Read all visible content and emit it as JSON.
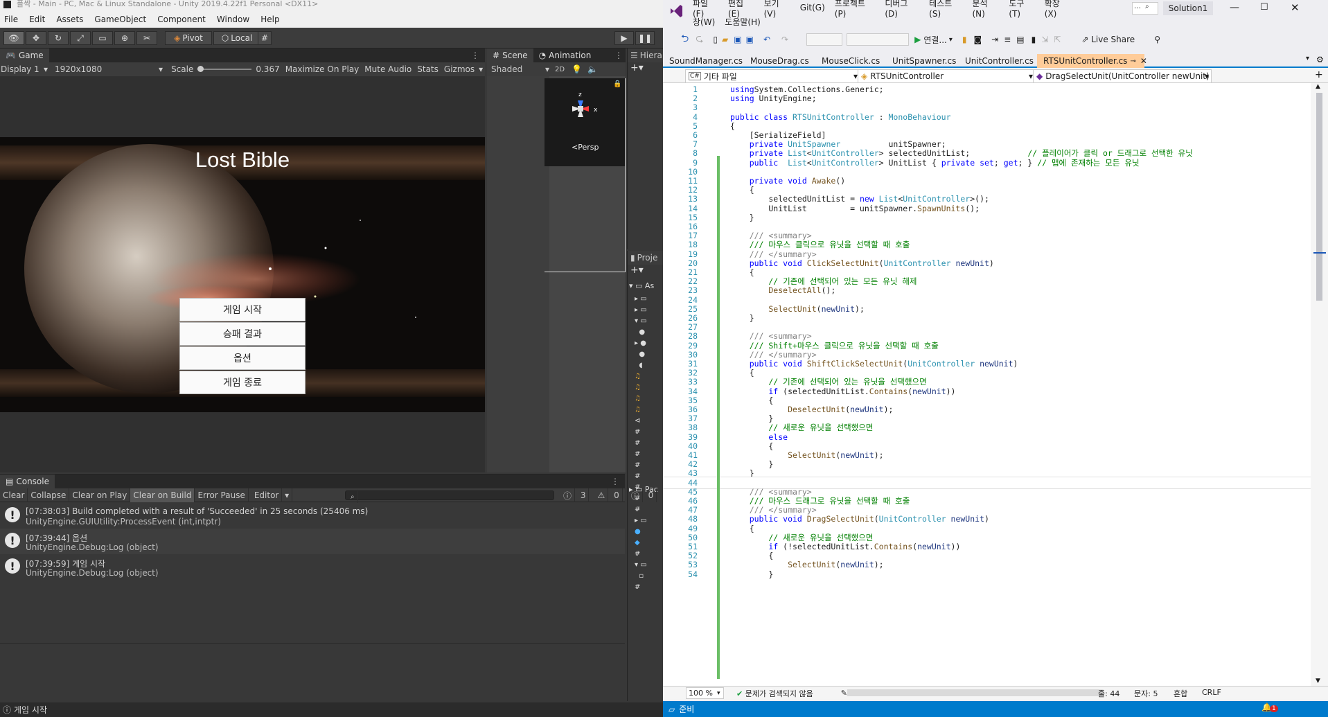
{
  "unity": {
    "window_title": "플싹 - Main - PC, Mac & Linux Standalone - Unity 2019.4.22f1 Personal <DX11>",
    "menu": [
      "File",
      "Edit",
      "Assets",
      "GameObject",
      "Component",
      "Window",
      "Help"
    ],
    "toolbar": {
      "pivot": "Pivot",
      "local": "Local"
    },
    "game_tab": "Game",
    "game_bar": {
      "display": "Display 1",
      "resolution": "1920x1080",
      "scale_label": "Scale",
      "scale_value": "0.367",
      "maximize": "Maximize On Play",
      "mute": "Mute Audio",
      "stats": "Stats",
      "gizmos": "Gizmos"
    },
    "game": {
      "title": "Lost Bible",
      "buttons": [
        "게임 시작",
        "승패 결과",
        "옵션",
        "게임 종료"
      ]
    },
    "scene_tabs": {
      "scene": "Scene",
      "animation": "Animation"
    },
    "scene_bar": {
      "shading": "Shaded",
      "mode": "2D"
    },
    "scene_persp": "Persp",
    "hierarchy_tab": "Hiera",
    "project_tab": "Proje",
    "project_root": "As",
    "project_pkg": "Pac",
    "console": {
      "tab": "Console",
      "toolbar": [
        "Clear",
        "Collapse",
        "Clear on Play",
        "Clear on Build",
        "Error Pause",
        "Editor"
      ],
      "counts": {
        "log": "3",
        "warn": "0",
        "error": "0"
      },
      "logs": [
        {
          "line1": "[07:38:03] Build completed with a result of 'Succeeded' in 25 seconds (25406 ms)",
          "line2": "UnityEngine.GUIUtility:ProcessEvent (int,intptr)"
        },
        {
          "line1": "[07:39:44] 옵션",
          "line2": "UnityEngine.Debug:Log (object)"
        },
        {
          "line1": "[07:39:59] 게임 시작",
          "line2": "UnityEngine.Debug:Log (object)"
        }
      ]
    },
    "status": "게임 시작"
  },
  "vs": {
    "menu": [
      "파일(F)",
      "편집(E)",
      "보기(V)",
      "Git(G)",
      "프로젝트(P)",
      "디버그(D)",
      "테스트(S)",
      "분석(N)",
      "도구(T)",
      "확장(X)"
    ],
    "menu2": [
      "창(W)",
      "도움말(H)"
    ],
    "solution": "Solution1",
    "run_label": "연결...",
    "live_share": "Live Share",
    "tabs": [
      "SoundManager.cs",
      "MouseDrag.cs",
      "MouseClick.cs",
      "UnitSpawner.cs",
      "UnitController.cs",
      "RTSUnitController.cs"
    ],
    "nav": {
      "project": "기타 파일",
      "class": "RTSUnitController",
      "member": "DragSelectUnit(UnitController newUnit)"
    },
    "zoom": "100 %",
    "issues": "문제가 검색되지 않음",
    "cursor": {
      "line": "줄: 44",
      "col": "문자: 5",
      "mode": "혼합",
      "eol": "CRLF"
    },
    "status": "준비",
    "notifications": "1"
  }
}
